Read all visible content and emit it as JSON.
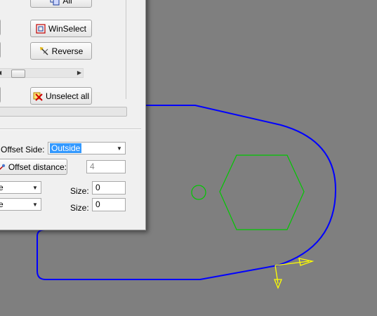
{
  "dialog": {
    "buttons": {
      "all": "All",
      "winselect": "WinSelect",
      "reverse": "Reverse",
      "unselect_all": "Unselect all",
      "offset_distance": "Offset distance:"
    },
    "offset_side": {
      "label": "Offset Side:",
      "value": "Outside"
    },
    "offset_distance_value": "4",
    "row1": {
      "combo_value": "e",
      "size_label": "Size:",
      "size_value": "0"
    },
    "row2": {
      "combo_value": "e",
      "size_label": "Size:",
      "size_value": "0"
    },
    "scrollbar_position": 0.12,
    "progress_fraction": 0
  },
  "colors": {
    "canvas_bg": "#7f7f7f",
    "profile": "#0000ff",
    "hexagon": "#00c800",
    "hole": "#00c800",
    "direction_arrows": "#ffff00"
  },
  "icons": [
    "select-all-icon",
    "winselect-icon",
    "reverse-icon",
    "unselect-all-icon",
    "offset-distance-icon"
  ]
}
